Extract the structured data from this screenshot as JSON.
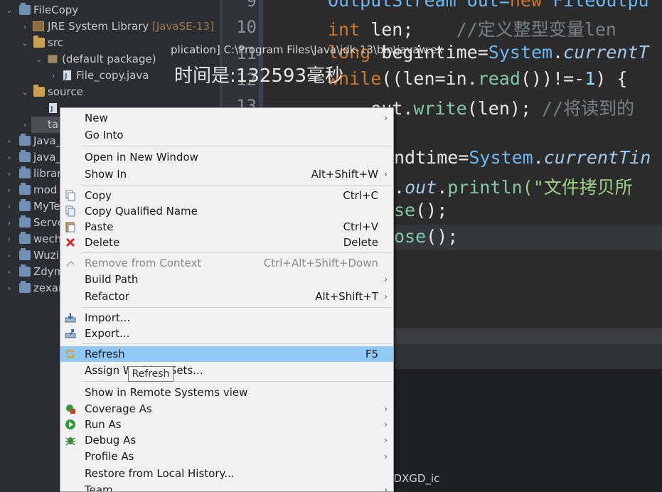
{
  "tree": {
    "items": [
      {
        "label": "FileCopy",
        "suffix": ""
      },
      {
        "label": "JRE System Library",
        "suffix": "[JavaSE-13]"
      },
      {
        "label": "src",
        "suffix": ""
      },
      {
        "label": "(default package)",
        "suffix": ""
      },
      {
        "label": "File_copy.java",
        "suffix": ""
      },
      {
        "label": "source",
        "suffix": ""
      },
      {
        "label": "ta",
        "suffix": ""
      },
      {
        "label": "Java_",
        "suffix": ""
      },
      {
        "label": "java_",
        "suffix": ""
      },
      {
        "label": "librar",
        "suffix": ""
      },
      {
        "label": "mod",
        "suffix": ""
      },
      {
        "label": "MyTe",
        "suffix": ""
      },
      {
        "label": "Serve",
        "suffix": ""
      },
      {
        "label": "wech",
        "suffix": ""
      },
      {
        "label": "Wuzi",
        "suffix": ""
      },
      {
        "label": "Zdym",
        "suffix": ""
      },
      {
        "label": "zexar",
        "suffix": ""
      }
    ]
  },
  "editor": {
    "line_numbers": [
      "9",
      "10",
      "11",
      "12",
      "13"
    ],
    "lines": {
      "l9": {
        "a": "OutputStream out=",
        "b": "new",
        "c": " FileOutpu"
      },
      "l10": {
        "a": "int",
        "b": " len;    ",
        "c": "//定义整型变量len"
      },
      "l11": {
        "a": "long",
        "b": " begintime=",
        "c": "System",
        "d": ".",
        "e": "currentT"
      },
      "l12": {
        "a": "while",
        "b": "((len=in.",
        "c": "read",
        "d": "())!=-",
        "e": "1",
        "f": ") {"
      },
      "l13": {
        "a": "    out.",
        "b": "write",
        "c": "(len); ",
        "d": "//将读到的"
      },
      "l15": {
        "a": "ndtime=",
        "b": "System",
        "c": ".",
        "d": "currentTin"
      },
      "l16": {
        "a": ".",
        "b": "out",
        "c": ".",
        "d": "println",
        "e": "(\"文件拷贝所"
      },
      "l17": {
        "a": "se",
        "b": "();"
      },
      "l18": {
        "a": "ose",
        "b": "();"
      }
    }
  },
  "console": {
    "path": "plication] C:\\Program Files\\Java\\jdk-13\\bin\\javaw.ex",
    "output": "时间是:132593毫秒"
  },
  "watermark": "https://blog.csdn.net/DXGD_ic",
  "menu": {
    "items": [
      {
        "label": "New",
        "key": "",
        "sub": true
      },
      {
        "label": "Go Into",
        "key": "",
        "sub": false
      },
      {
        "label": "Open in New Window",
        "key": "",
        "sub": false
      },
      {
        "label": "Show In",
        "key": "Alt+Shift+W",
        "sub": true
      },
      {
        "label": "Copy",
        "key": "Ctrl+C",
        "sub": false
      },
      {
        "label": "Copy Qualified Name",
        "key": "",
        "sub": false
      },
      {
        "label": "Paste",
        "key": "Ctrl+V",
        "sub": false
      },
      {
        "label": "Delete",
        "key": "Delete",
        "sub": false
      },
      {
        "label": "Remove from Context",
        "key": "Ctrl+Alt+Shift+Down",
        "sub": false
      },
      {
        "label": "Build Path",
        "key": "",
        "sub": true
      },
      {
        "label": "Refactor",
        "key": "Alt+Shift+T",
        "sub": true
      },
      {
        "label": "Import...",
        "key": "",
        "sub": false
      },
      {
        "label": "Export...",
        "key": "",
        "sub": false
      },
      {
        "label": "Refresh",
        "key": "F5",
        "sub": false
      },
      {
        "label": "Assign Working Sets...",
        "key": "",
        "sub": false
      },
      {
        "label": "Show in Remote Systems view",
        "key": "",
        "sub": false
      },
      {
        "label": "Coverage As",
        "key": "",
        "sub": true
      },
      {
        "label": "Run As",
        "key": "",
        "sub": true
      },
      {
        "label": "Debug As",
        "key": "",
        "sub": true
      },
      {
        "label": "Profile As",
        "key": "",
        "sub": true
      },
      {
        "label": "Restore from Local History...",
        "key": "",
        "sub": false
      },
      {
        "label": "Team",
        "key": "",
        "sub": true
      }
    ],
    "tooltip": "Refresh",
    "submenu_glyph": "›"
  },
  "colors": {
    "menu_highlight": "#90c8f6",
    "keyword": "#cc7832",
    "type": "#6bb8f2"
  }
}
